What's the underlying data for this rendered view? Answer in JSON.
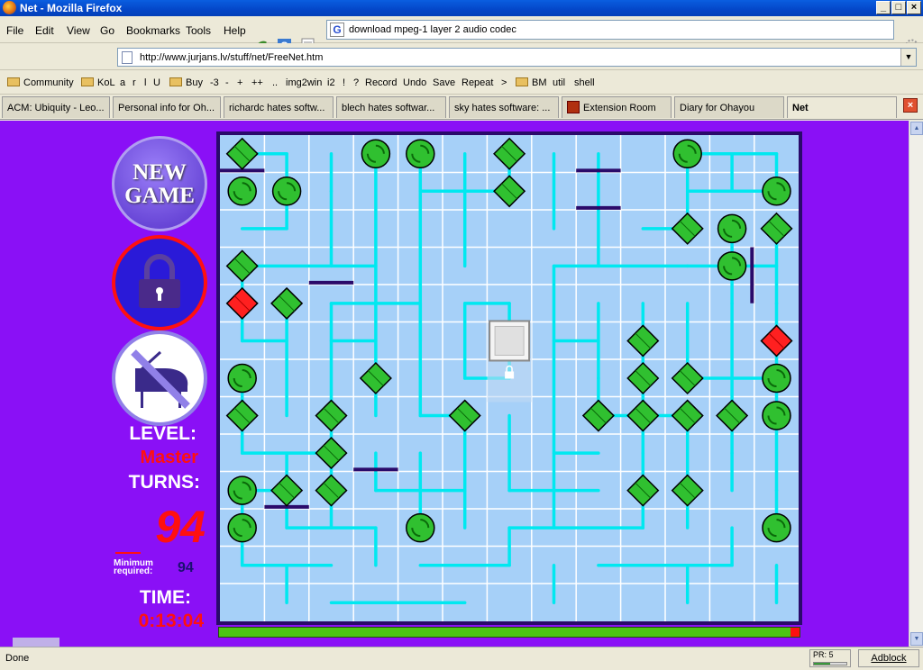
{
  "window": {
    "title": "Net - Mozilla Firefox"
  },
  "menu": [
    "File",
    "Edit",
    "View",
    "Go",
    "Bookmarks",
    "Tools",
    "Help"
  ],
  "search": {
    "value": "download mpeg-1 layer 2 audio codec",
    "engine_icon": "G"
  },
  "nav": {
    "url": "http://www.jurjans.lv/stuff/net/FreeNet.htm"
  },
  "bookmarks": [
    "Community",
    "KoL",
    "a",
    "r",
    "l",
    "U",
    "Buy",
    "-3",
    "-",
    "+",
    "++",
    "..",
    "img2win",
    "i2",
    "!",
    "?",
    "Record",
    "Undo",
    "Save",
    "Repeat",
    ">",
    "BM",
    "util",
    "shell"
  ],
  "tabs": [
    "ACM: Ubiquity - Leo...",
    "Personal info for Oh...",
    "richardc hates softw...",
    "blech hates softwar...",
    "sky hates software: ...",
    "Extension Room",
    "Diary for Ohayou",
    "Net"
  ],
  "active_tab": 7,
  "game": {
    "new_game_label": "NEW GAME",
    "level_label": "LEVEL:",
    "level_value": "Master",
    "turns_label": "TURNS:",
    "turns_value": "94",
    "minimum_label": "Minimum required:",
    "minimum_value": "94",
    "time_label": "TIME:",
    "time_value": "0:13:04",
    "progress": 0.985,
    "colors": {
      "background": "#8a10f6",
      "board": "#a6d0f8",
      "wire": "#00e8f0",
      "node": "#30c030",
      "unpowered": "#ff2020",
      "accent": "#ff1010"
    }
  },
  "status": {
    "text": "Done",
    "pr": "PR: 5",
    "adblock": "Adblock"
  }
}
